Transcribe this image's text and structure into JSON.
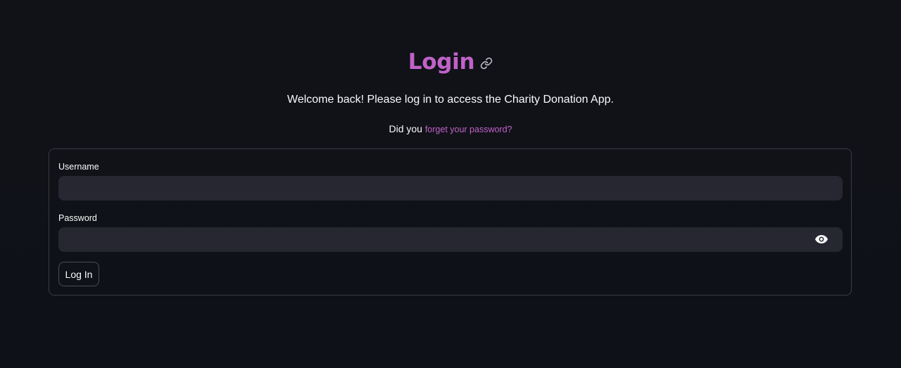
{
  "header": {
    "title": "Login",
    "title_color": "#c062c8",
    "anchor_icon": "link-icon"
  },
  "intro": {
    "welcome_text": "Welcome back! Please log in to access the Charity Donation App.",
    "forgot_prefix": "Did you",
    "forgot_link_text": "forget your password?",
    "link_color": "#c062c8"
  },
  "form": {
    "username_label": "Username",
    "username_value": "",
    "password_label": "Password",
    "password_value": "",
    "password_toggle_icon": "eye-icon",
    "submit_label": "Log In"
  },
  "theme": {
    "background": "#111218",
    "input_background": "#262730",
    "border": "#3a3c46",
    "text": "#fafafa"
  }
}
